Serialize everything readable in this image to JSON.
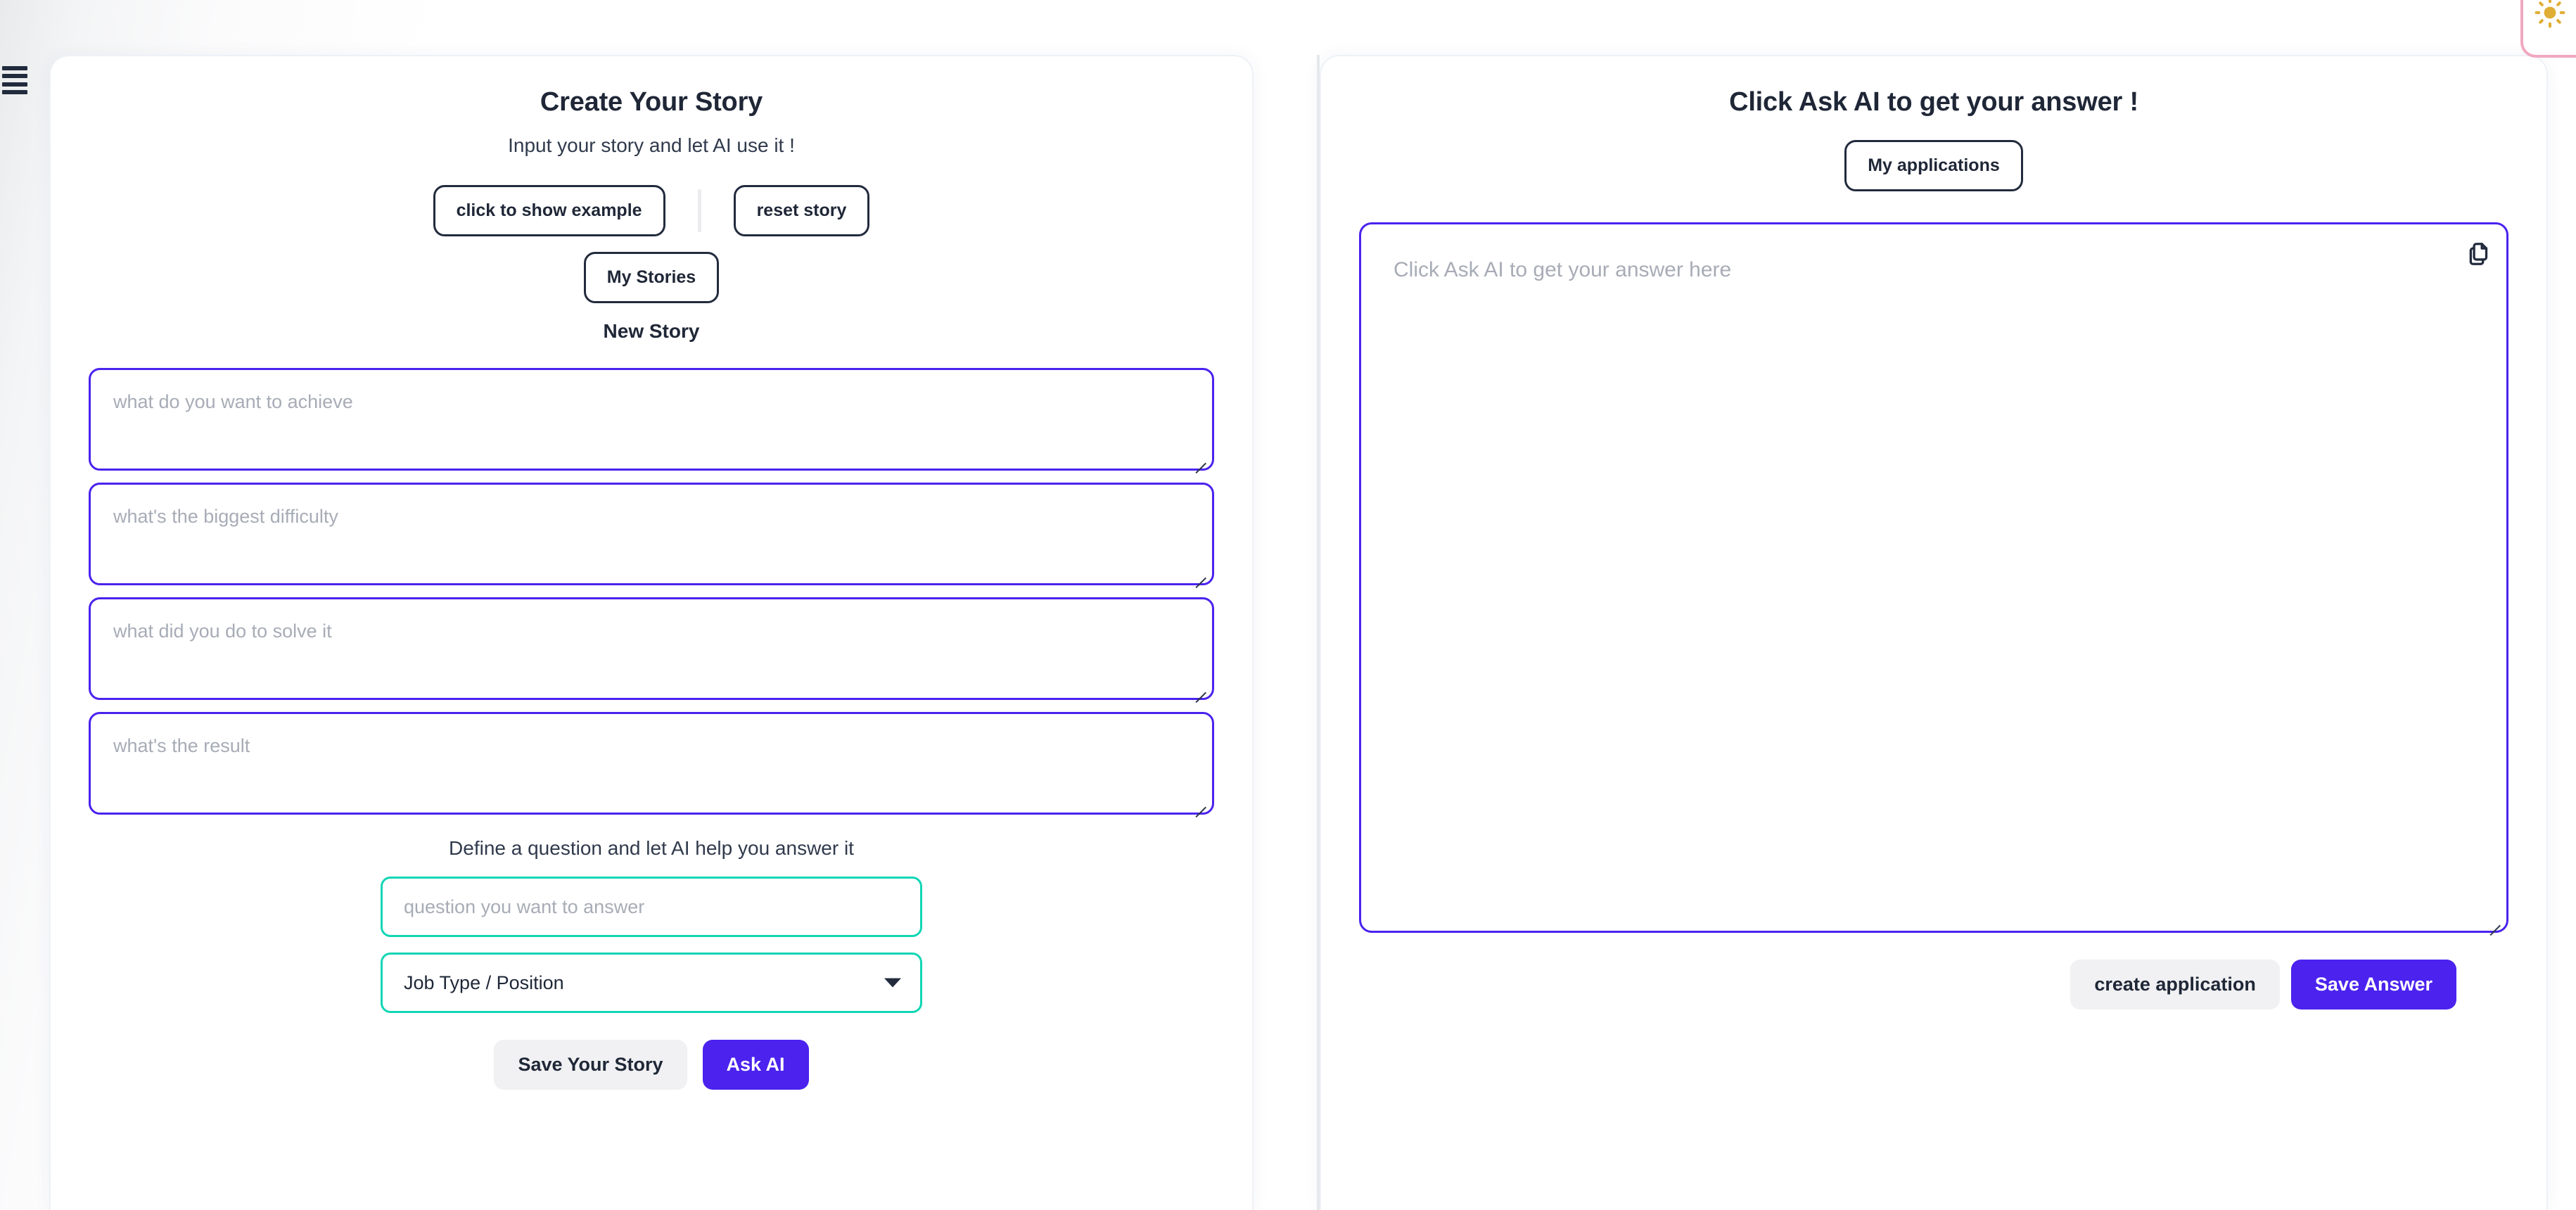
{
  "global": {
    "menu_icon": "hamburger-menu-icon",
    "theme_toggle_icon": "sun-icon",
    "accent_purple": "#4b22ee",
    "accent_teal": "#12d6b4",
    "text_dark": "#1f2737",
    "sun_color": "#e0ae35",
    "toggle_border": "#f0a8c0"
  },
  "left_panel": {
    "title": "Create Your Story",
    "subtitle": "Input your story and let AI use it !",
    "show_example_label": "click to show example",
    "reset_story_label": "reset story",
    "my_stories_label": "My Stories",
    "new_story_label": "New Story",
    "fields": [
      {
        "name": "achieve",
        "placeholder": "what do you want to achieve",
        "value": ""
      },
      {
        "name": "difficulty",
        "placeholder": "what's the biggest difficulty",
        "value": ""
      },
      {
        "name": "solve",
        "placeholder": "what did you do to solve it",
        "value": ""
      },
      {
        "name": "result",
        "placeholder": "what's the result",
        "value": ""
      }
    ],
    "question_caption": "Define a question and let AI help you answer it",
    "question_placeholder": "question you want to answer",
    "question_value": "",
    "job_type_selected": "Job Type / Position",
    "job_type_options": [
      "Job Type / Position"
    ],
    "save_story_label": "Save Your Story",
    "ask_ai_label": "Ask AI"
  },
  "right_panel": {
    "title": "Click Ask AI to get your answer !",
    "my_applications_label": "My applications",
    "answer_placeholder": "Click Ask AI to get your answer here",
    "answer_value": "",
    "copy_icon": "copy-icon",
    "create_application_label": "create application",
    "save_answer_label": "Save Answer"
  }
}
